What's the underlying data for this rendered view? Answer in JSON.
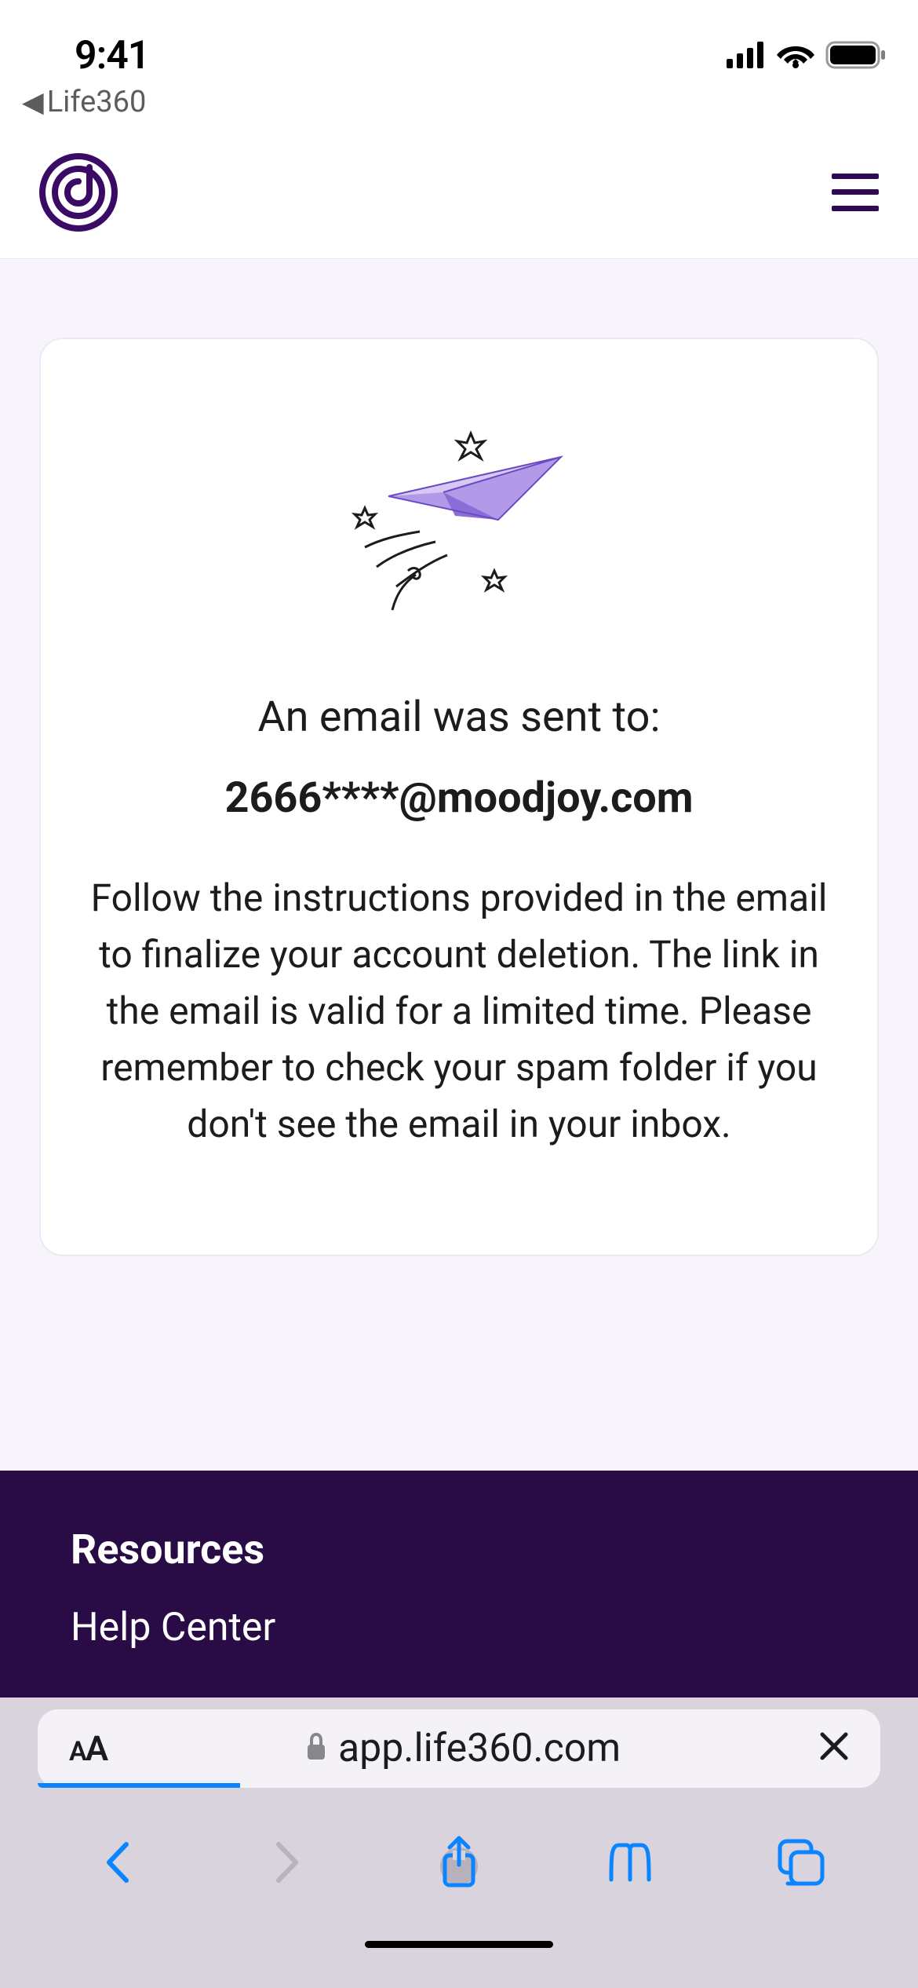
{
  "statusBar": {
    "time": "9:41"
  },
  "backApp": {
    "label": "Life360"
  },
  "card": {
    "title": "An email was sent to:",
    "email": "2666****@moodjoy.com",
    "body": "Follow the instructions provided in the email to finalize your account deletion. The link in the email is valid for a limited time. Please remember to check your spam folder if you don't see the email in your inbox."
  },
  "footer": {
    "heading": "Resources",
    "link1": "Help Center"
  },
  "urlBar": {
    "domain": "app.life360.com"
  }
}
